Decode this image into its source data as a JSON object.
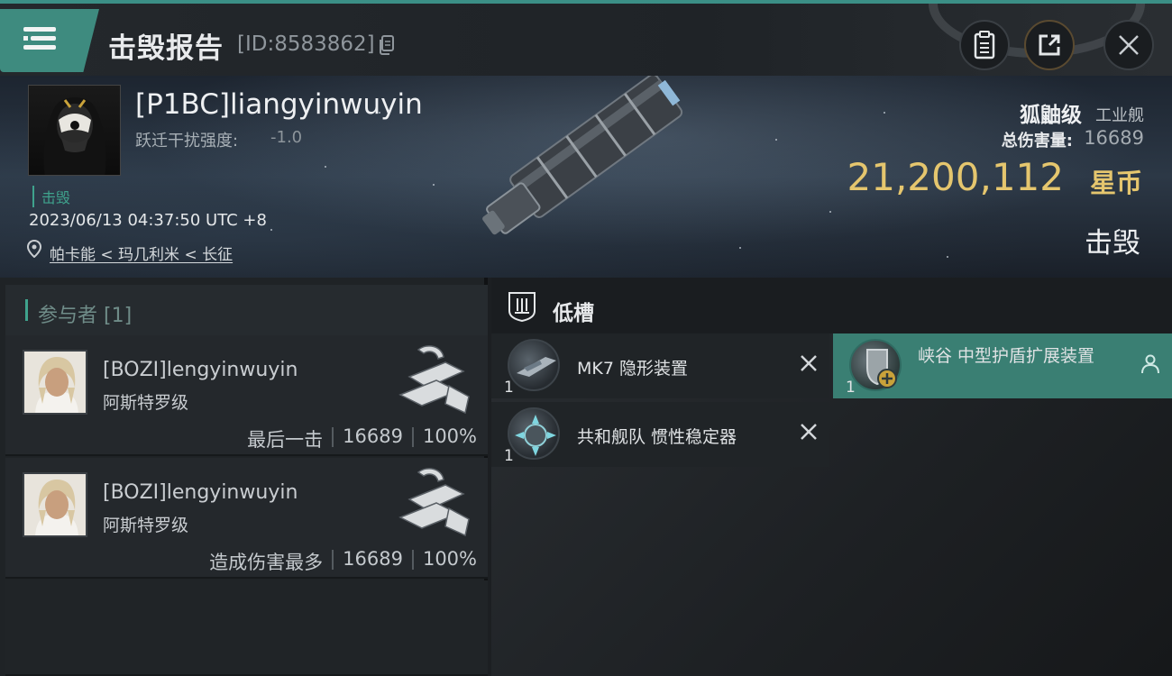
{
  "header": {
    "title": "击毁报告",
    "report_id": "[ID:8583862]"
  },
  "victim": {
    "name": "[P1BC]liangyinwuyin",
    "warp_label": "跃迁干扰强度:",
    "warp_value": "-1.0",
    "status": "击毁",
    "timestamp": "2023/06/13 04:37:50 UTC +8",
    "location": "帕卡能 < 玛几利米 < 长征",
    "ship_class": "狐鼬级",
    "ship_type": "工业舰",
    "damage_label": "总伤害量:",
    "damage_value": "16689",
    "isk_value": "21,200,112",
    "isk_unit": "星币",
    "result": "击毁"
  },
  "participants": {
    "header": "参与者 [1]",
    "rows": [
      {
        "name": "[BOZI]lengyinwuyin",
        "ship": "阿斯特罗级",
        "role": "最后一击",
        "damage": "16689",
        "percent": "100%"
      },
      {
        "name": "[BOZI]lengyinwuyin",
        "ship": "阿斯特罗级",
        "role": "造成伤害最多",
        "damage": "16689",
        "percent": "100%"
      }
    ]
  },
  "fitting": {
    "slot_title": "低槽",
    "modules": [
      {
        "name": "MK7 隐形装置",
        "qty": "1",
        "state": "destroyed"
      },
      {
        "name": "共和舰队 惯性稳定器",
        "qty": "1",
        "state": "destroyed"
      },
      {
        "name": "峡谷 中型护盾扩展装置",
        "qty": "1",
        "state": "dropped"
      }
    ]
  },
  "icons": {
    "menu": "menu-icon",
    "copy": "copy-icon",
    "clipboard": "clipboard-icon",
    "share": "share-icon",
    "close": "close-icon",
    "location": "location-pin-icon",
    "slot": "low-slot-icon",
    "remove": "x-mark-icon",
    "person": "person-icon"
  },
  "colors": {
    "accent": "#3e8b7f",
    "isk": "#e5c66e",
    "status": "#3fa38d",
    "dropped_bg": "#3a7f73"
  }
}
